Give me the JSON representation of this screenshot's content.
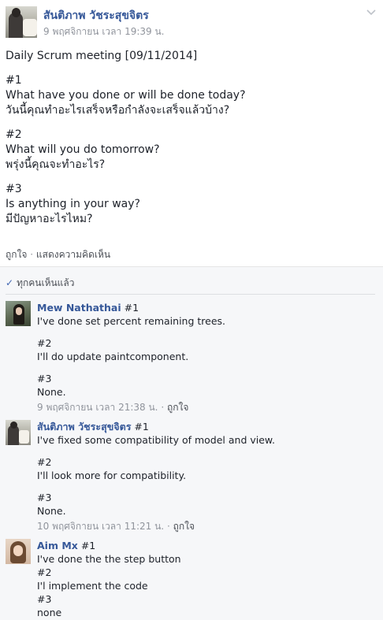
{
  "post": {
    "author": "สันติภาพ วัชระสุขจิตร",
    "time": "9 พฤศจิกายน เวลา 19:39 น.",
    "lines": [
      "Daily Scrum meeting [09/11/2014]",
      "#1",
      "What have you done or will be done today?",
      "วันนี้คุณทำอะไรเสร็จหรือกำลังจะเสร็จแล้วบ้าง?",
      "#2",
      "What will you do tomorrow?",
      "พรุ่งนี้คุณจะทำอะไร?",
      "#3",
      "Is anything in your way?",
      "มีปัญหาอะไรไหม?"
    ],
    "like_label": "ถูกใจ",
    "separator": "·",
    "comment_label": "แสดงความคิดเห็น"
  },
  "seen": {
    "label": "ทุกคนเห็นแล้ว"
  },
  "comments": [
    {
      "author": "Mew Nathathai",
      "first_line": "#1",
      "lines": [
        "I've done set percent remaining trees.",
        "",
        "#2",
        "I'll do update paintcomponent.",
        "",
        "#3",
        "None."
      ],
      "time": "9 พฤศจิกายน เวลา 21:38 น.",
      "like_label": "ถูกใจ"
    },
    {
      "author": "สันติภาพ วัชระสุขจิตร",
      "first_line": "#1",
      "lines": [
        "I've fixed some compatibility of model and view.",
        "",
        "#2",
        "I'll look more for compatibility.",
        "",
        "#3",
        "None."
      ],
      "time": "10 พฤศจิกายน เวลา 11:21 น.",
      "like_label": "ถูกใจ"
    },
    {
      "author": "Aim Mx",
      "first_line": "#1",
      "lines": [
        "I've done the the step button",
        "#2",
        "I'l implement the code",
        "#3",
        "none"
      ]
    }
  ],
  "icons": {
    "chevron": "chevron-down-icon",
    "check": "check-icon"
  },
  "colors": {
    "link": "#365899",
    "meta": "#90949c",
    "comments_bg": "#f6f7f9"
  }
}
